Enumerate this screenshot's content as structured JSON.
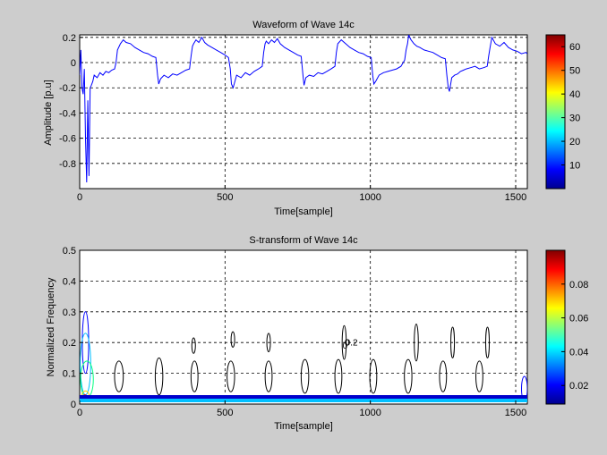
{
  "chart_data": [
    {
      "type": "line",
      "title": "Waveform of Wave 14c",
      "xlabel": "Time[sample]",
      "ylabel": "Amplitude [p.u]",
      "xlim": [
        0,
        1540
      ],
      "ylim": [
        -1,
        0.22
      ],
      "xticks": [
        0,
        500,
        1000,
        1500
      ],
      "xtick_labels": [
        "0",
        "500",
        "1000",
        "1500"
      ],
      "yticks": [
        0.2,
        0,
        -0.2,
        -0.4,
        -0.6,
        -0.8
      ],
      "ytick_labels": [
        "0.2",
        "0",
        "-0.2",
        "-0.4",
        "-0.6",
        "-0.8"
      ],
      "grid": true,
      "line_color": "#0000ff",
      "series": [
        {
          "x": [
            0,
            4,
            8,
            12,
            16,
            20,
            24,
            28,
            32,
            36,
            40,
            45,
            50,
            60,
            70,
            80,
            90,
            100,
            110,
            120,
            125,
            130,
            140,
            150,
            160,
            175,
            190,
            205,
            220,
            235,
            250,
            262,
            268,
            272,
            278,
            290,
            305,
            320,
            335,
            350,
            365,
            378,
            383,
            388,
            392,
            400,
            410,
            420,
            430,
            440,
            455,
            470,
            485,
            500,
            512,
            518,
            522,
            528,
            540,
            555,
            570,
            585,
            600,
            615,
            628,
            633,
            638,
            642,
            650,
            660,
            670,
            680,
            690,
            705,
            720,
            735,
            750,
            762,
            768,
            772,
            778,
            790,
            805,
            820,
            835,
            850,
            865,
            878,
            883,
            888,
            892,
            900,
            915,
            930,
            945,
            960,
            975,
            990,
            1003,
            1008,
            1012,
            1018,
            1030,
            1045,
            1060,
            1075,
            1090,
            1105,
            1118,
            1123,
            1128,
            1132,
            1140,
            1150,
            1160,
            1170,
            1185,
            1200,
            1215,
            1230,
            1245,
            1258,
            1263,
            1268,
            1272,
            1280,
            1290,
            1300,
            1310,
            1320,
            1330,
            1345,
            1360,
            1375,
            1390,
            1402,
            1407,
            1412,
            1418,
            1430,
            1445,
            1460,
            1475,
            1490,
            1505,
            1520,
            1535,
            1540
          ],
          "y": [
            -0.1,
            0.1,
            -0.2,
            -0.25,
            -0.05,
            -0.6,
            -0.95,
            -0.3,
            -0.9,
            -0.2,
            -0.18,
            -0.15,
            -0.1,
            -0.12,
            -0.08,
            -0.1,
            -0.07,
            -0.08,
            -0.06,
            -0.05,
            0.0,
            0.1,
            0.15,
            0.18,
            0.16,
            0.15,
            0.12,
            0.1,
            0.08,
            0.07,
            0.05,
            0.04,
            -0.1,
            -0.17,
            -0.13,
            -0.1,
            -0.12,
            -0.09,
            -0.1,
            -0.08,
            -0.06,
            -0.05,
            0.05,
            0.13,
            0.15,
            0.18,
            0.16,
            0.2,
            0.16,
            0.14,
            0.12,
            0.1,
            0.08,
            0.06,
            0.04,
            -0.05,
            -0.17,
            -0.2,
            -0.1,
            -0.12,
            -0.08,
            -0.1,
            -0.07,
            -0.05,
            -0.03,
            0.08,
            0.15,
            0.17,
            0.15,
            0.18,
            0.16,
            0.19,
            0.15,
            0.12,
            0.1,
            0.08,
            0.06,
            0.05,
            -0.1,
            -0.18,
            -0.12,
            -0.1,
            -0.11,
            -0.08,
            -0.09,
            -0.07,
            -0.05,
            -0.03,
            0.08,
            0.15,
            0.16,
            0.18,
            0.15,
            0.12,
            0.1,
            0.08,
            0.07,
            0.05,
            0.04,
            -0.1,
            -0.17,
            -0.15,
            -0.1,
            -0.08,
            -0.07,
            -0.06,
            -0.05,
            -0.03,
            0.02,
            0.1,
            0.15,
            0.22,
            0.18,
            0.15,
            0.13,
            0.12,
            0.1,
            0.09,
            0.08,
            0.06,
            0.04,
            0.03,
            -0.1,
            -0.2,
            -0.23,
            -0.12,
            -0.1,
            -0.09,
            -0.07,
            -0.06,
            -0.05,
            -0.04,
            -0.03,
            -0.05,
            -0.04,
            -0.03,
            0.05,
            0.12,
            0.2,
            0.15,
            0.13,
            0.16,
            0.12,
            0.1,
            0.09,
            0.07,
            0.08,
            0.07
          ]
        }
      ]
    },
    {
      "type": "contour",
      "title": "S-transform of Wave 14c",
      "xlabel": "Time[sample]",
      "ylabel": "Normalized Frequency",
      "xlim": [
        0,
        1540
      ],
      "ylim": [
        0,
        0.5
      ],
      "xticks": [
        0,
        500,
        1000,
        1500
      ],
      "xtick_labels": [
        "0",
        "500",
        "1000",
        "1500"
      ],
      "yticks": [
        0,
        0.1,
        0.2,
        0.3,
        0.4,
        0.5
      ],
      "ytick_labels": [
        "0",
        "0.1",
        "0.2",
        "0.3",
        "0.4",
        "0.5"
      ],
      "grid": true,
      "contour_labels": [
        "0",
        "0",
        "0.2"
      ],
      "contours": [
        {
          "x": 20,
          "y": 0.2,
          "w": 22,
          "h": 0.2,
          "color": "#0000ff"
        },
        {
          "x": 20,
          "y": 0.13,
          "w": 36,
          "h": 0.2,
          "color": "#00bfff"
        },
        {
          "x": 25,
          "y": 0.08,
          "w": 44,
          "h": 0.12,
          "color": "#00ff80"
        },
        {
          "x": 20,
          "y": 0.025,
          "w": 26,
          "h": 0.035,
          "color": "#ffd700"
        },
        {
          "x": 18,
          "y": 0.02,
          "w": 16,
          "h": 0.02,
          "color": "#ff0000"
        },
        {
          "x": 135,
          "y": 0.09,
          "w": 30,
          "h": 0.1,
          "color": "#000000"
        },
        {
          "x": 273,
          "y": 0.09,
          "w": 26,
          "h": 0.12,
          "color": "#000000"
        },
        {
          "x": 395,
          "y": 0.09,
          "w": 24,
          "h": 0.1,
          "color": "#000000"
        },
        {
          "x": 392,
          "y": 0.19,
          "w": 8,
          "h": 0.05,
          "color": "#000000"
        },
        {
          "x": 520,
          "y": 0.09,
          "w": 26,
          "h": 0.1,
          "color": "#000000"
        },
        {
          "x": 527,
          "y": 0.21,
          "w": 8,
          "h": 0.05,
          "color": "#000000"
        },
        {
          "x": 650,
          "y": 0.09,
          "w": 24,
          "h": 0.1,
          "color": "#000000"
        },
        {
          "x": 650,
          "y": 0.2,
          "w": 10,
          "h": 0.06,
          "color": "#000000"
        },
        {
          "x": 775,
          "y": 0.09,
          "w": 26,
          "h": 0.11,
          "color": "#000000"
        },
        {
          "x": 890,
          "y": 0.09,
          "w": 24,
          "h": 0.11,
          "color": "#000000"
        },
        {
          "x": 910,
          "y": 0.2,
          "w": 14,
          "h": 0.11,
          "color": "#000000"
        },
        {
          "x": 1010,
          "y": 0.09,
          "w": 24,
          "h": 0.11,
          "color": "#000000"
        },
        {
          "x": 1130,
          "y": 0.09,
          "w": 26,
          "h": 0.11,
          "color": "#000000"
        },
        {
          "x": 1158,
          "y": 0.2,
          "w": 14,
          "h": 0.12,
          "color": "#000000"
        },
        {
          "x": 1250,
          "y": 0.09,
          "w": 24,
          "h": 0.1,
          "color": "#000000"
        },
        {
          "x": 1283,
          "y": 0.2,
          "w": 10,
          "h": 0.1,
          "color": "#000000"
        },
        {
          "x": 1375,
          "y": 0.09,
          "w": 24,
          "h": 0.1,
          "color": "#000000"
        },
        {
          "x": 1403,
          "y": 0.2,
          "w": 10,
          "h": 0.1,
          "color": "#000000"
        },
        {
          "x": 1530,
          "y": 0.05,
          "w": 20,
          "h": 0.08,
          "color": "#0000ff"
        }
      ]
    }
  ],
  "colorbars": [
    {
      "ticks": [
        "10",
        "20",
        "30",
        "40",
        "50",
        "60"
      ],
      "tick_values": [
        10,
        20,
        30,
        40,
        50,
        60
      ],
      "range": [
        0,
        65
      ]
    },
    {
      "ticks": [
        "0.02",
        "0.04",
        "0.06",
        "0.08"
      ],
      "tick_values": [
        0.02,
        0.04,
        0.06,
        0.08
      ],
      "range": [
        0.009,
        0.1
      ]
    }
  ],
  "colormap": [
    "#00008f",
    "#0000ff",
    "#0080ff",
    "#00ffff",
    "#80ff80",
    "#ffff00",
    "#ff8000",
    "#ff0000",
    "#800000"
  ]
}
